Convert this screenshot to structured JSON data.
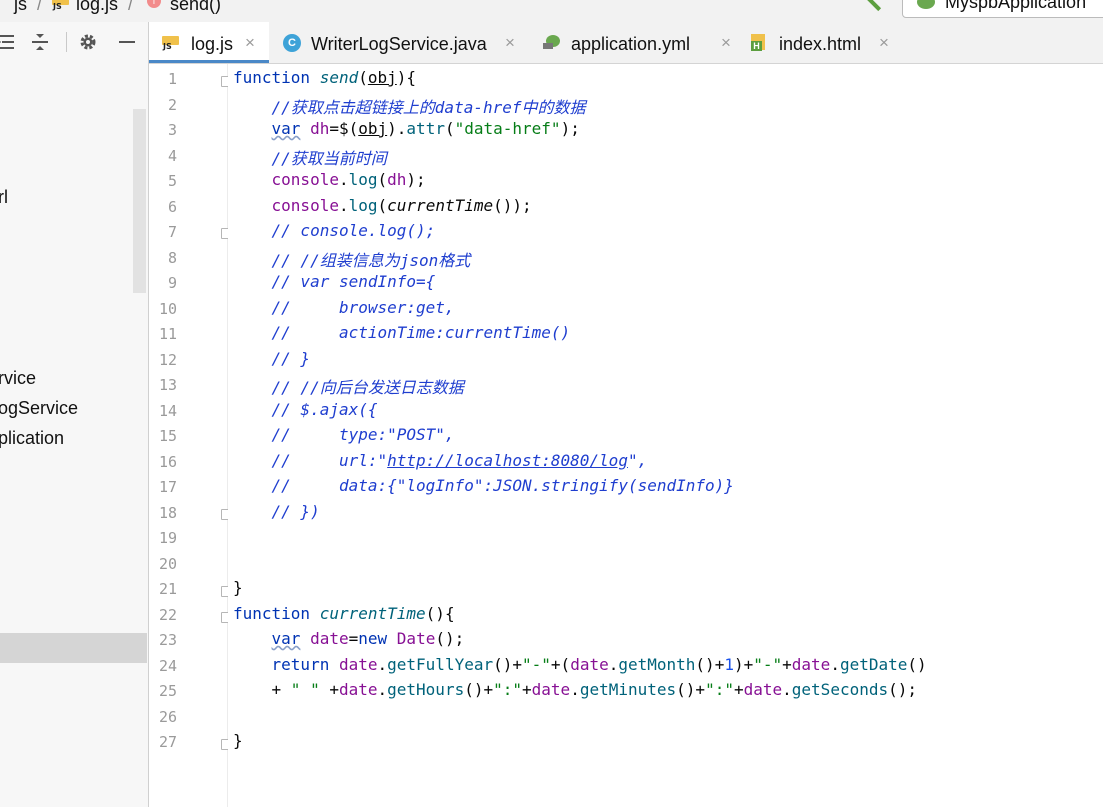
{
  "breadcrumb": {
    "items": [
      {
        "label": "js",
        "icon": "folder-icon"
      },
      {
        "label": "log.js",
        "icon": "js-file-icon"
      },
      {
        "label": "send()",
        "icon": "function-icon"
      }
    ],
    "separator": "/"
  },
  "run_config": {
    "label": "MyspbApplication",
    "icon": "spring-boot-icon"
  },
  "project_toolbar": {
    "icons": [
      "expand-all-icon",
      "collapse-all-icon",
      "gear-icon",
      "minimize-icon"
    ]
  },
  "project_tree": {
    "visible_fragments": [
      "rl",
      "rvice",
      "ogService",
      "plication"
    ]
  },
  "tabs": [
    {
      "label": "log.js",
      "icon": "js-file-icon",
      "active": true
    },
    {
      "label": "WriterLogService.java",
      "icon": "java-class-icon",
      "active": false
    },
    {
      "label": "application.yml",
      "icon": "spring-yml-icon",
      "active": false
    },
    {
      "label": "index.html",
      "icon": "html-file-icon",
      "active": false
    }
  ],
  "tab_close_glyph": "×",
  "editor": {
    "current_line": 13,
    "line_numbers": [
      "1",
      "2",
      "3",
      "4",
      "5",
      "6",
      "7",
      "8",
      "9",
      "10",
      "11",
      "12",
      "13",
      "14",
      "15",
      "16",
      "17",
      "18",
      "19",
      "20",
      "21",
      "22",
      "23",
      "24",
      "25",
      "26",
      "27"
    ],
    "code": {
      "l1": {
        "kw": "function ",
        "fn": "send",
        "p1": "(",
        "arg": "obj",
        "p2": "){"
      },
      "l2": {
        "text": "    //获取点击超链接上的data-href中的数据"
      },
      "l3": {
        "indent": "    ",
        "kw": "var",
        "sp": " ",
        "v": "dh",
        "eq": "=$(",
        "arg": "obj",
        "p": ").",
        "m": "attr",
        "op": "(",
        "s": "\"data-href\"",
        "end": ");"
      },
      "l4": {
        "text": "    //获取当前时间"
      },
      "l5": {
        "indent": "    ",
        "obj": "console",
        "dot": ".",
        "m": "log",
        "op": "(",
        "v": "dh",
        "end": ");"
      },
      "l6": {
        "indent": "    ",
        "obj": "console",
        "dot": ".",
        "m": "log",
        "op": "(",
        "fn": "currentTime",
        "end": "());"
      },
      "l7": {
        "text": "    // console.log();"
      },
      "l8": {
        "text": "    // //组装信息为json格式"
      },
      "l9": {
        "text": "    // var sendInfo={"
      },
      "l10": {
        "text": "    //     browser:get,"
      },
      "l11": {
        "text": "    //     actionTime:currentTime()"
      },
      "l12": {
        "text": "    // }"
      },
      "l13": {
        "text": "    // //向后台发送日志数据"
      },
      "l14": {
        "text": "    // $.ajax({"
      },
      "l15": {
        "text": "    //     type:\"POST\","
      },
      "l16": {
        "pre": "    //     url:\"",
        "url": "http://localhost:8080/log",
        "post": "\","
      },
      "l17": {
        "text": "    //     data:{\"logInfo\":JSON.stringify(sendInfo)}"
      },
      "l18": {
        "text": "    // })"
      },
      "l21": {
        "text": "}"
      },
      "l22": {
        "kw": "function ",
        "fn": "currentTime",
        "end": "(){"
      },
      "l23": {
        "indent": "    ",
        "kw": "var",
        "sp": " ",
        "v": "date",
        "eq": "=",
        "kw2": "new",
        "sp2": " ",
        "cls": "Date",
        "end": "();"
      },
      "l24": {
        "indent": "    ",
        "kw": "return",
        "sp": " ",
        "a": "date",
        "b": ".",
        "c": "getFullYear",
        "d": "()+",
        "e": "\"-\"",
        "f": "+(",
        "g": "date",
        "h": ".",
        "i": "getMonth",
        "j": "()+",
        "k": "1",
        "l": ")+",
        "m": "\"-\"",
        "n": "+",
        "o": "date",
        "p": ".",
        "q": "getDate",
        "r": "()"
      },
      "l25": {
        "indent": "    ",
        "plus": "+ ",
        "s1": "\" \"",
        "sp": " +",
        "a": "date",
        "b": ".",
        "c": "getHours",
        "d": "()+",
        "e": "\":\"",
        "f": "+",
        "g": "date",
        "h": ".",
        "i": "getMinutes",
        "j": "()+",
        "k": "\":\"",
        "l": "+",
        "m": "date",
        "n": ".",
        "o": "getSeconds",
        "p": "();"
      },
      "l27": {
        "text": "}"
      }
    }
  },
  "colors": {
    "keyword": "#0033b3",
    "comment": "#1f3ecf",
    "string": "#067d17",
    "number": "#1750eb",
    "method": "#00627a",
    "variable": "#871094",
    "active_tab_underline": "#4a88c7",
    "caret_line": "#fdfbe6"
  }
}
